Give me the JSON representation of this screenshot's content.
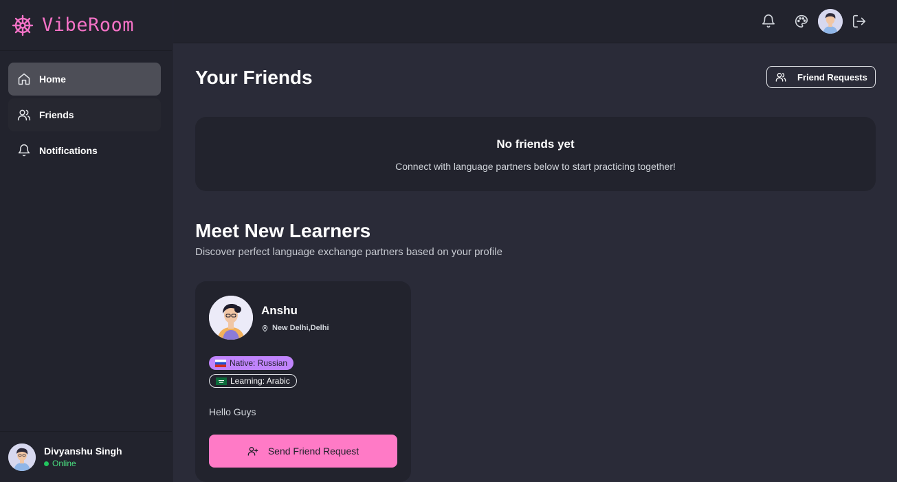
{
  "app": {
    "name": "VibeRoom",
    "brand_color": "#f472c6"
  },
  "sidebar": {
    "items": [
      {
        "label": "Home",
        "icon": "home-icon",
        "active": true
      },
      {
        "label": "Friends",
        "icon": "users-icon",
        "active": false
      },
      {
        "label": "Notifications",
        "icon": "bell-icon",
        "active": false
      }
    ],
    "user": {
      "name": "Divyanshu Singh",
      "status": "Online"
    }
  },
  "topbar": {
    "icons": [
      "bell-icon",
      "palette-icon",
      "avatar",
      "logout-icon"
    ]
  },
  "friends": {
    "title": "Your Friends",
    "requests_button": "Friend Requests",
    "empty_title": "No friends yet",
    "empty_subtitle": "Connect with language partners below to start practicing together!"
  },
  "learners": {
    "title": "Meet New Learners",
    "subtitle": "Discover perfect language exchange partners based on your profile",
    "cards": [
      {
        "name": "Anshu",
        "location": "New Delhi,Delhi",
        "native": "Native: Russian",
        "learning": "Learning: Arabic",
        "bio": "Hello Guys",
        "button": "Send Friend Request"
      }
    ]
  }
}
